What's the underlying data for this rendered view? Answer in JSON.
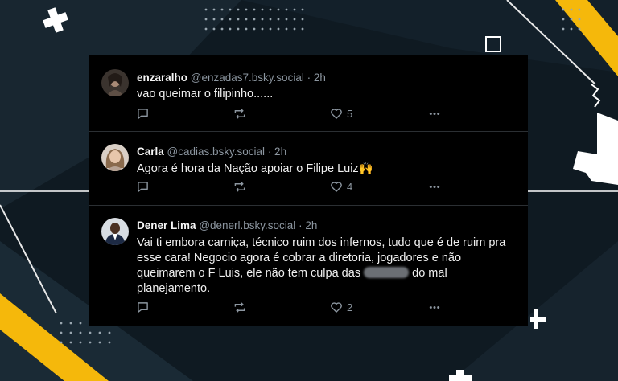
{
  "colors": {
    "background": "#0f1a22",
    "accent_yellow": "#f5b80b",
    "card": "#000000",
    "handle_gray": "#8c96a0"
  },
  "posts": [
    {
      "name": "enzaralho",
      "handle": "@enzadas7.bsky.social",
      "time": "· 2h",
      "text": "vao queimar o filipinho......",
      "likes": "5",
      "icons": [
        "reply-icon",
        "repost-icon",
        "like-icon",
        "more-icon"
      ]
    },
    {
      "name": "Carla",
      "handle": "@cadias.bsky.social",
      "time": "· 2h",
      "text": "Agora é hora da Nação apoiar o Filipe Luiz",
      "emoji": "🙌",
      "likes": "4",
      "icons": [
        "reply-icon",
        "repost-icon",
        "like-icon",
        "more-icon"
      ]
    },
    {
      "name": "Dener Lima",
      "handle": "@denerl.bsky.social",
      "time": "· 2h",
      "text_before": "Vai ti embora carniça, técnico ruim dos infernos, tudo que é de ruim pra esse cara! Negocio agora é cobrar a diretoria, jogadores e não queimarem o F Luis, ele não tem culpa das",
      "text_after": "do mal planejamento.",
      "likes": "2",
      "icons": [
        "reply-icon",
        "repost-icon",
        "like-icon",
        "more-icon"
      ]
    }
  ]
}
